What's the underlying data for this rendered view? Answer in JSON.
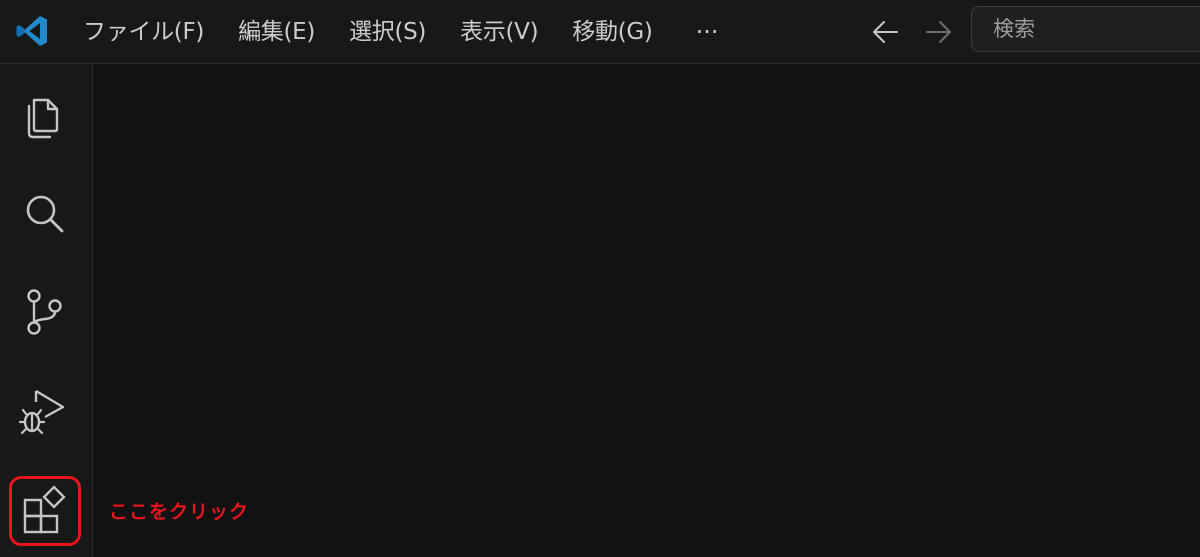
{
  "titlebar": {
    "menu": [
      {
        "label": "ファイル(F)"
      },
      {
        "label": "編集(E)"
      },
      {
        "label": "選択(S)"
      },
      {
        "label": "表示(V)"
      },
      {
        "label": "移動(G)"
      }
    ],
    "more_label": "···",
    "search_placeholder": "検索"
  },
  "activity_bar": {
    "items": [
      {
        "icon": "files-icon"
      },
      {
        "icon": "search-icon"
      },
      {
        "icon": "source-control-icon"
      },
      {
        "icon": "run-and-debug-icon"
      },
      {
        "icon": "extensions-icon",
        "highlighted": true
      }
    ]
  },
  "annotation": {
    "text": "ここをクリック",
    "color": "#e8161c"
  },
  "colors": {
    "background": "#181818",
    "editor": "#121212",
    "icon": "#c5c5c5",
    "logo_blue": "#2489ca"
  }
}
